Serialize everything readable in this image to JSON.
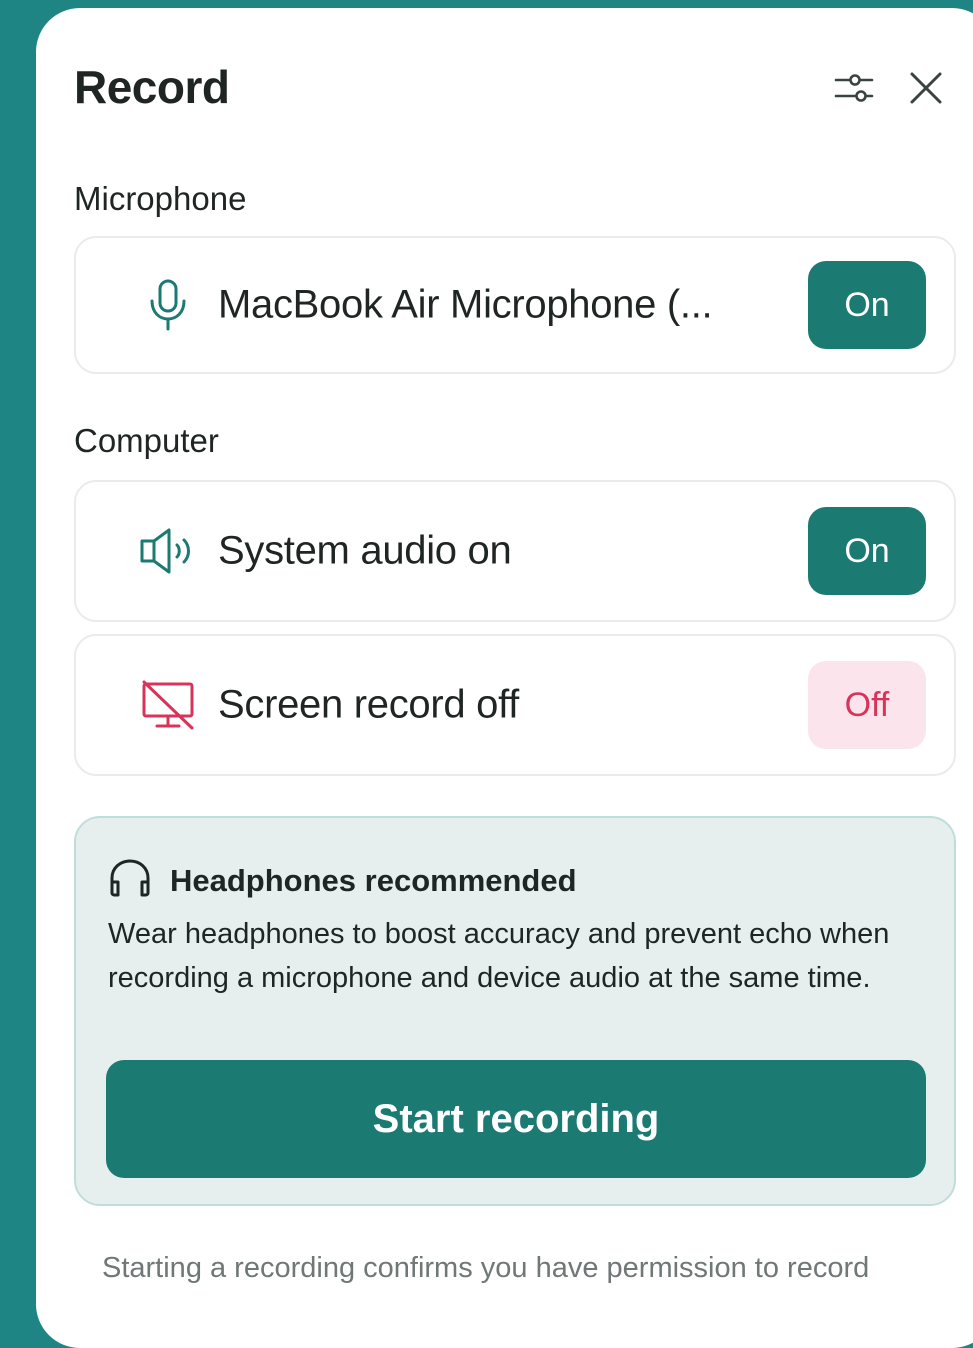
{
  "header": {
    "title": "Record",
    "settings_icon": "sliders-icon",
    "close_icon": "close-icon"
  },
  "microphone": {
    "section_label": "Microphone",
    "device_name": "MacBook Air Microphone (...",
    "icon": "microphone-icon",
    "toggle_label": "On"
  },
  "computer": {
    "section_label": "Computer",
    "system_audio": {
      "label": "System audio on",
      "icon": "speaker-icon",
      "toggle_label": "On"
    },
    "screen_record": {
      "label": "Screen record off",
      "icon": "screen-off-icon",
      "toggle_label": "Off"
    }
  },
  "info": {
    "icon": "headphones-icon",
    "title": "Headphones recommended",
    "body": "Wear headphones to boost accuracy and prevent echo when recording a microphone and device audio at the same time."
  },
  "start_button_label": "Start recording",
  "footer_note": "Starting a recording confirms you have permission to record",
  "colors": {
    "background": "#1f8584",
    "accent": "#1b7a72",
    "off_bg": "#fbe4ec",
    "off_text": "#d8345a",
    "info_bg": "#e6efee"
  }
}
